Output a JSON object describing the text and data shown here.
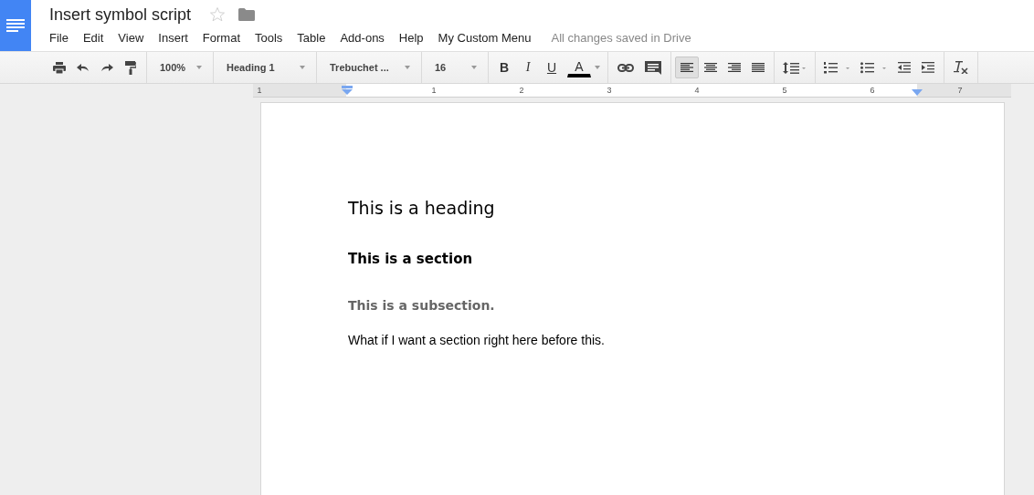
{
  "document": {
    "title": "Insert symbol script",
    "starred": false
  },
  "menu": [
    "File",
    "Edit",
    "View",
    "Insert",
    "Format",
    "Tools",
    "Table",
    "Add-ons",
    "Help",
    "My Custom Menu"
  ],
  "save_status": "All changes saved in Drive",
  "toolbar": {
    "zoom": "100%",
    "style": "Heading 1",
    "font": "Trebuchet ...",
    "size": "16",
    "format_buttons": [
      {
        "label": "B",
        "kind": "bold"
      },
      {
        "label": "I",
        "kind": "italic"
      },
      {
        "label": "U",
        "kind": "underline"
      },
      {
        "label": "A",
        "kind": "color"
      }
    ],
    "align_buttons": [
      {
        "kind": "left",
        "selected": true
      },
      {
        "kind": "center",
        "selected": false
      },
      {
        "kind": "right",
        "selected": false
      },
      {
        "kind": "justify",
        "selected": false
      }
    ]
  },
  "ruler": {
    "labels": [
      "1",
      "1",
      "2",
      "3",
      "4",
      "5",
      "6",
      "7"
    ]
  },
  "page": {
    "paragraphs": [
      {
        "kind": "heading",
        "text": "This is a heading"
      },
      {
        "kind": "section",
        "text": "This is a section"
      },
      {
        "kind": "subsection",
        "text": "This is a subsection."
      },
      {
        "kind": "normal",
        "text": "What if I want a section right here before this."
      }
    ]
  }
}
